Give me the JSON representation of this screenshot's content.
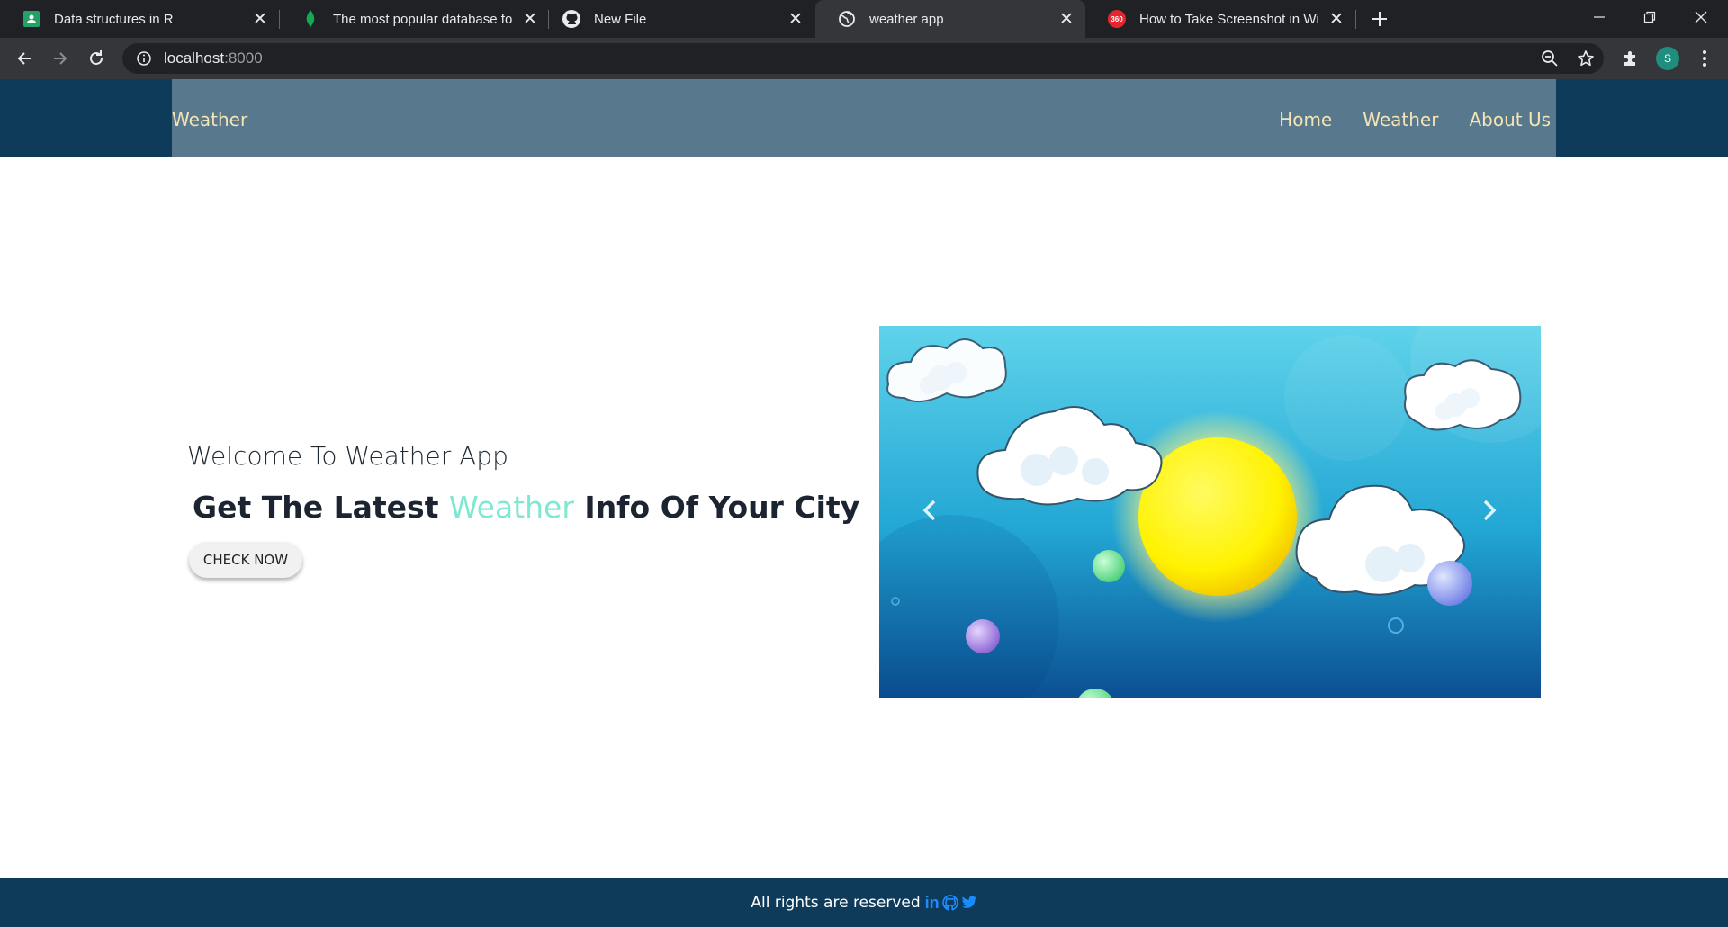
{
  "browser": {
    "tabs": [
      {
        "title": "Data structures in R",
        "icon": "google-classroom-icon",
        "active": false
      },
      {
        "title": "The most popular database for m",
        "icon": "mongodb-leaf-icon",
        "active": false
      },
      {
        "title": "New File",
        "icon": "github-icon",
        "active": false
      },
      {
        "title": "weather app",
        "icon": "globe-icon",
        "active": true
      },
      {
        "title": "How to Take Screenshot in Windo",
        "icon": "360-icon",
        "active": false
      }
    ],
    "tab_360_label": "360",
    "address": {
      "host": "localhost",
      "port": ":8000"
    },
    "profile_initial": "S"
  },
  "navbar": {
    "brand": "Weather",
    "links": [
      "Home",
      "Weather",
      "About Us"
    ]
  },
  "hero": {
    "welcome": "Welcome To Weather App",
    "headline_before": "Get The Latest ",
    "headline_highlight": "Weather",
    "headline_after": " Info Of Your City",
    "cta_label": "CHECK NOW"
  },
  "carousel": {
    "slide_image": "sun-and-clouds-illustration"
  },
  "footer": {
    "text": "All rights are reserved",
    "social_icons": [
      "linkedin-icon",
      "github-icon",
      "twitter-icon"
    ],
    "linkedin_label": "in"
  },
  "colors": {
    "header_bg": "#0e3b5a",
    "navbar_bg": "#58788e",
    "nav_text": "#f5e4b4",
    "accent": "#7fe8d2",
    "social": "#1a8cff"
  }
}
